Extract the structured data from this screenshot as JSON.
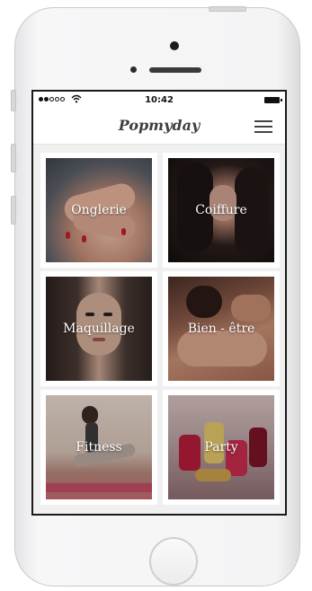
{
  "status_bar": {
    "time": "10:42"
  },
  "app": {
    "title": "Popmyday"
  },
  "categories": [
    {
      "label": "Onglerie"
    },
    {
      "label": "Coiffure"
    },
    {
      "label": "Maquillage"
    },
    {
      "label": "Bien - être"
    },
    {
      "label": "Fitness"
    },
    {
      "label": "Party"
    }
  ],
  "icons": {
    "menu": "hamburger-menu-icon",
    "signal": "signal-dots-icon",
    "wifi": "wifi-icon",
    "battery": "battery-icon"
  }
}
